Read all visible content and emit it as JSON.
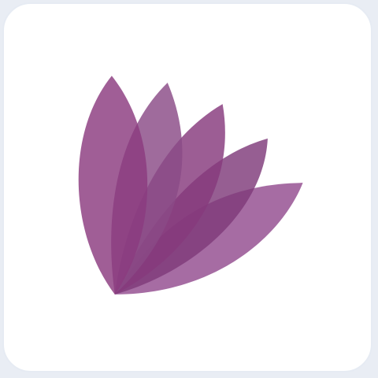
{
  "app_icon": {
    "icon": "lotus-flower-logo-icon",
    "tile_background": "#ffffff",
    "tile_border": "#e6ebf3",
    "page_background": "#e9edf4",
    "petal_colors": [
      "#8b3a7f",
      "#8a4a86",
      "#86397d",
      "#7f3a7a",
      "#934c8f"
    ],
    "petal_opacity": 0.82
  }
}
